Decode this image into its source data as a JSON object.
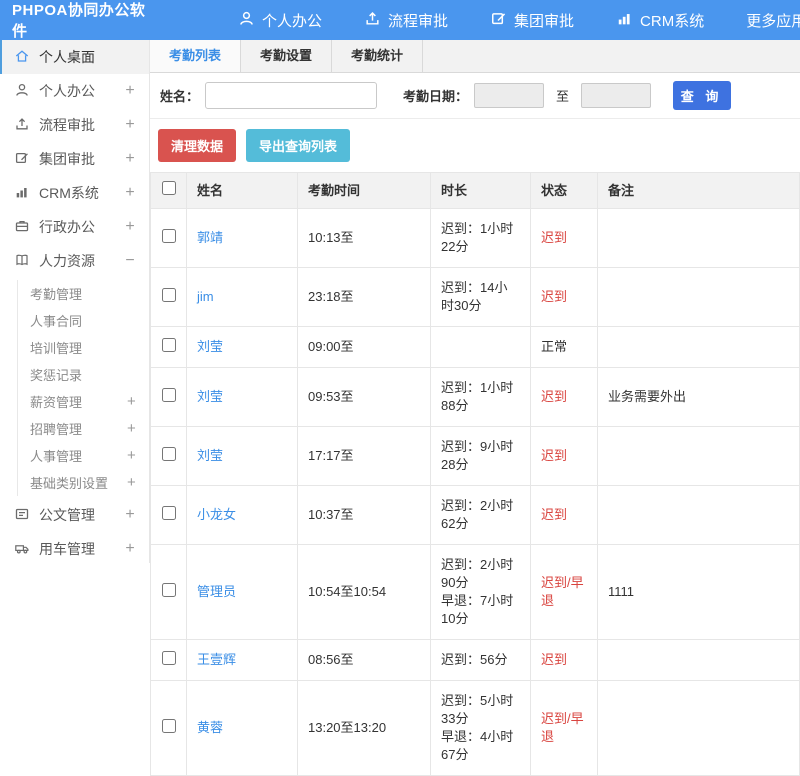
{
  "app": {
    "logo": "PHPOA协同办公软件"
  },
  "header": {
    "nav": [
      {
        "label": "个人办公",
        "icon": "person-icon"
      },
      {
        "label": "流程审批",
        "icon": "flow-approval-icon"
      },
      {
        "label": "集团审批",
        "icon": "edit-icon"
      },
      {
        "label": "CRM系统",
        "icon": "bar-chart-icon"
      },
      {
        "label": "更多应用",
        "icon": "caret-down-icon"
      }
    ]
  },
  "sidebar": {
    "items": [
      {
        "label": "个人桌面",
        "icon": "home-icon",
        "expand": ""
      },
      {
        "label": "个人办公",
        "icon": "person-icon",
        "expand": "+"
      },
      {
        "label": "流程审批",
        "icon": "flow-approval-icon",
        "expand": "+"
      },
      {
        "label": "集团审批",
        "icon": "edit-icon",
        "expand": "+"
      },
      {
        "label": "CRM系统",
        "icon": "bar-chart-icon",
        "expand": "+"
      },
      {
        "label": "行政办公",
        "icon": "briefcase-icon",
        "expand": "+"
      },
      {
        "label": "人力资源",
        "icon": "book-icon",
        "expand": "−"
      },
      {
        "label": "公文管理",
        "icon": "document-icon",
        "expand": "+"
      },
      {
        "label": "用车管理",
        "icon": "car-icon",
        "expand": "+"
      }
    ],
    "hr_submenu": [
      {
        "label": "考勤管理",
        "expand": ""
      },
      {
        "label": "人事合同",
        "expand": ""
      },
      {
        "label": "培训管理",
        "expand": ""
      },
      {
        "label": "奖惩记录",
        "expand": ""
      },
      {
        "label": "薪资管理",
        "expand": "+"
      },
      {
        "label": "招聘管理",
        "expand": "+"
      },
      {
        "label": "人事管理",
        "expand": "+"
      },
      {
        "label": "基础类别设置",
        "expand": "+"
      }
    ]
  },
  "tabs": [
    {
      "label": "考勤列表"
    },
    {
      "label": "考勤设置"
    },
    {
      "label": "考勤统计"
    }
  ],
  "search": {
    "name_label": "姓名：",
    "name_value": "",
    "date_label": "考勤日期：",
    "date_from": "",
    "to_label": "至",
    "date_to": "",
    "query_button": "查 询"
  },
  "toolbar": {
    "clean_button": "清理数据",
    "export_button": "导出查询列表"
  },
  "table": {
    "headers": [
      "姓名",
      "考勤时间",
      "时长",
      "状态",
      "备注"
    ],
    "rows": [
      {
        "name": "郭靖",
        "time": "10:13至",
        "d1": "迟到：1小时22分",
        "d2": "",
        "status": "迟到",
        "note": ""
      },
      {
        "name": "jim",
        "time": "23:18至",
        "d1": "迟到：14小时30分",
        "d2": "",
        "status": "迟到",
        "note": ""
      },
      {
        "name": "刘莹",
        "time": "09:00至",
        "d1": "",
        "d2": "",
        "status": "正常",
        "note": ""
      },
      {
        "name": "刘莹",
        "time": "09:53至",
        "d1": "迟到：1小时88分",
        "d2": "",
        "status": "迟到",
        "note": "业务需要外出"
      },
      {
        "name": "刘莹",
        "time": "17:17至",
        "d1": "迟到：9小时28分",
        "d2": "",
        "status": "迟到",
        "note": ""
      },
      {
        "name": "小龙女",
        "time": "10:37至",
        "d1": "迟到：2小时62分",
        "d2": "",
        "status": "迟到",
        "note": ""
      },
      {
        "name": "管理员",
        "time": "10:54至10:54",
        "d1": "迟到：2小时90分",
        "d2": "早退：7小时10分",
        "status": "迟到/早退",
        "note": "1111"
      },
      {
        "name": "王壹辉",
        "time": "08:56至",
        "d1": "迟到：56分",
        "d2": "",
        "status": "迟到",
        "note": ""
      },
      {
        "name": "黄蓉",
        "time": "13:20至13:20",
        "d1": "迟到：5小时33分",
        "d2": "早退：4小时67分",
        "status": "迟到/早退",
        "note": ""
      }
    ]
  },
  "colors": {
    "header_bg": "#4a96ee",
    "accent_link": "#3a8ee6",
    "status_red": "#d9443f",
    "query_btn": "#3e72e0",
    "danger_btn": "#d9534f",
    "info_btn": "#54bcd9"
  }
}
